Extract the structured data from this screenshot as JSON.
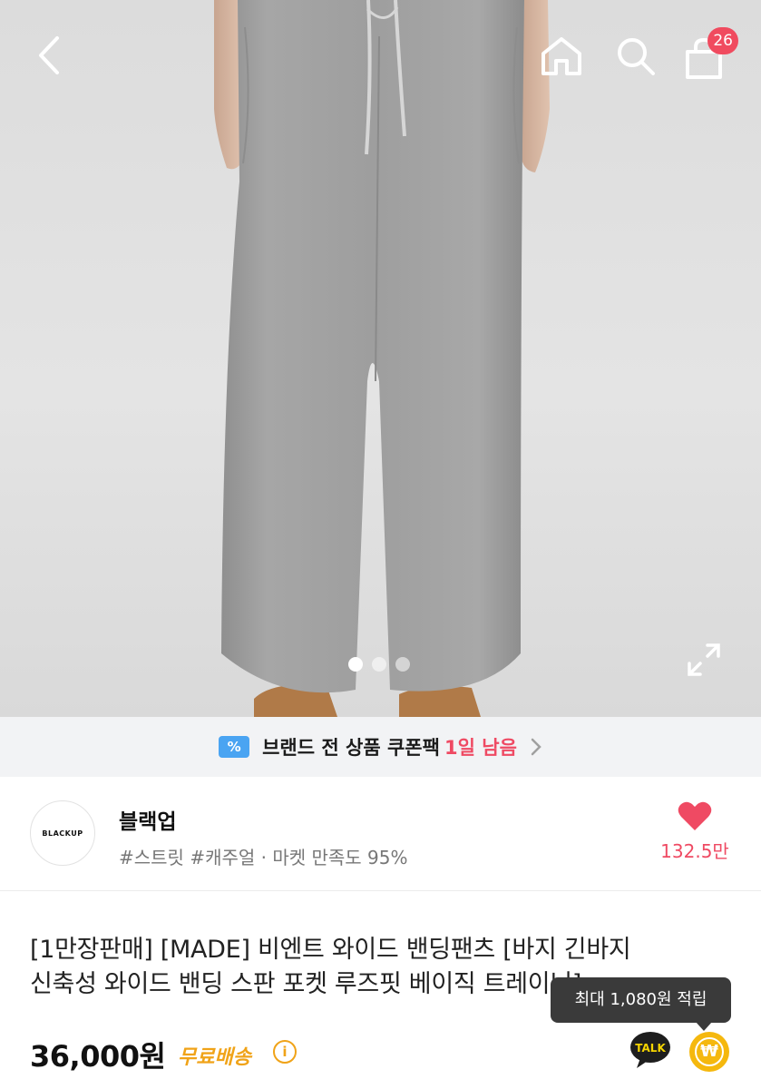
{
  "header": {
    "cart_count": "26"
  },
  "icons": {
    "back": "chevron-left-icon",
    "home": "home-icon",
    "search": "search-icon",
    "cart": "shopping-bag-icon",
    "expand": "expand-icon",
    "like": "heart-icon",
    "info": "info-icon",
    "talk": "kakao-talk-icon",
    "point": "won-point-icon"
  },
  "gallery": {
    "total_images": 3,
    "active_index": 0
  },
  "coupon": {
    "icon_text": "%",
    "text": "브랜드 전 상품 쿠폰팩",
    "remaining": "1일 남음"
  },
  "seller": {
    "logo_text": "BLACKUP",
    "name": "블랙업",
    "tags": "#스트릿 #캐주얼 · 마켓 만족도 95%",
    "like_count": "132.5만"
  },
  "product": {
    "title_line1": "[1만장판매] [MADE] 비엔트 와이드 밴딩팬츠 [바지 긴바지",
    "title_line2": "신축성 와이드 밴딩 스판 포켓 루즈핏 베이직 트레이닝]",
    "price": "36,000원",
    "shipping": "무료배송",
    "info_symbol": "i"
  },
  "reward": {
    "tooltip": "최대 1,080원 적립",
    "talk_label": "TALK",
    "point_symbol": "₩"
  },
  "colors": {
    "accent_pink": "#ef4a63",
    "shipping_orange": "#f0a318",
    "coupon_blue": "#4aa4f2",
    "point_yellow": "#f5b80e"
  }
}
